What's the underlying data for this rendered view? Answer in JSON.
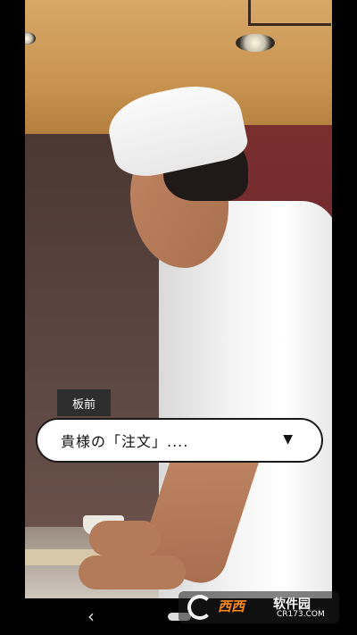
{
  "dialogue": {
    "speaker": "板前",
    "text": "貴様の「注文」....",
    "advance_icon": "▼"
  },
  "navbar": {
    "back_icon": "‹"
  },
  "watermark": {
    "brand": "西西",
    "text": "软件园",
    "url": "CR173.COM"
  }
}
